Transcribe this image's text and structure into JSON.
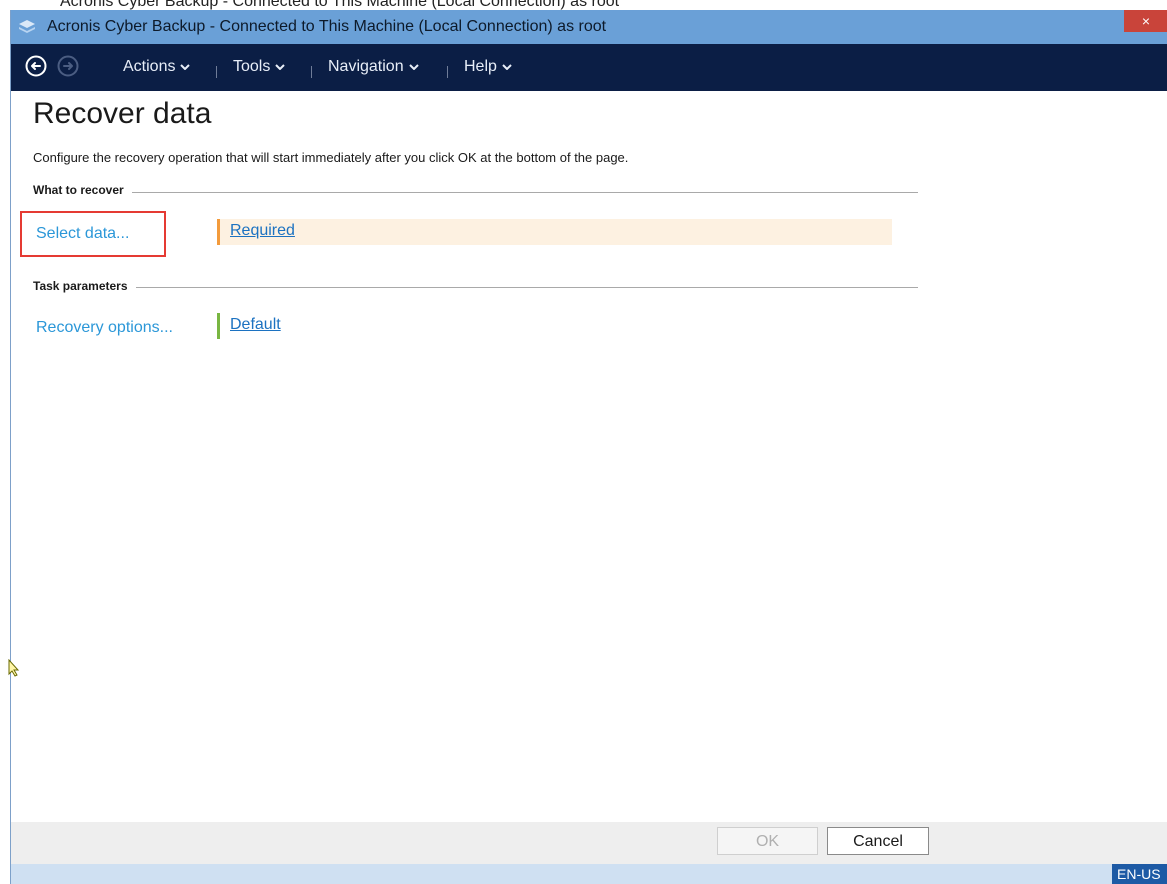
{
  "window": {
    "title": "Acronis Cyber Backup - Connected to This Machine (Local Connection) as root",
    "close_label": "×"
  },
  "menubar": {
    "items": [
      {
        "label": "Actions"
      },
      {
        "label": "Tools"
      },
      {
        "label": "Navigation"
      },
      {
        "label": "Help"
      }
    ]
  },
  "page": {
    "title": "Recover data",
    "description": "Configure the recovery operation that will start immediately after you click OK at the bottom of the page.",
    "sections": {
      "what_to_recover": {
        "label": "What to recover",
        "select_label": "Select data...",
        "status_text": "Required",
        "status_color": "#f39b3c"
      },
      "task_parameters": {
        "label": "Task parameters",
        "options_label": "Recovery options...",
        "status_text": "Default",
        "status_color": "#79b642"
      }
    }
  },
  "footer": {
    "ok_label": "OK",
    "cancel_label": "Cancel"
  },
  "status_bar": {
    "language": "EN-US"
  },
  "icons": {
    "back": "back-arrow-icon",
    "forward": "forward-arrow-icon",
    "app": "app-stack-icon",
    "caret": "chevron-down-icon",
    "cursor": "mouse-cursor-icon"
  }
}
